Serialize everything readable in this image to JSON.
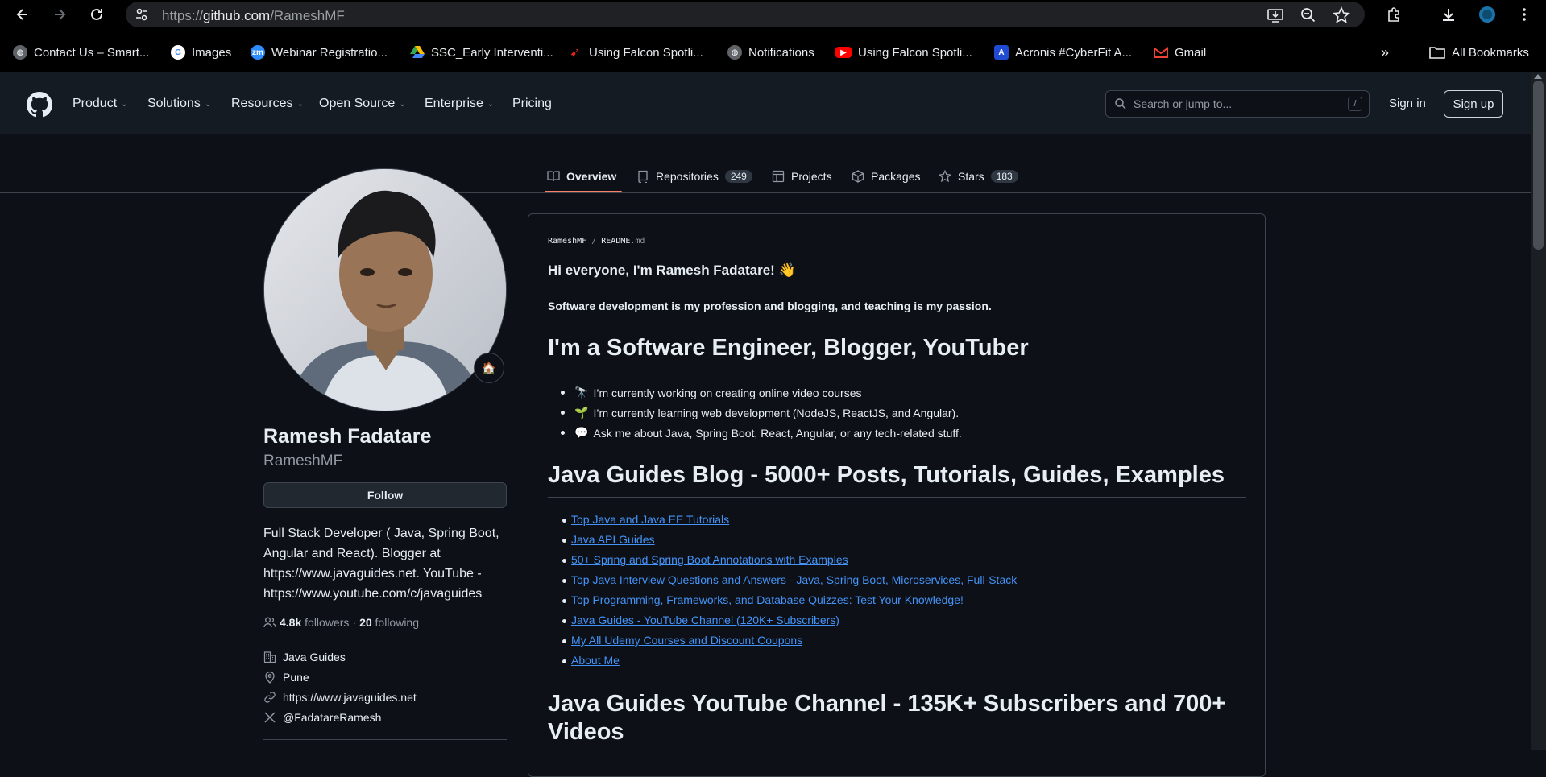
{
  "browser": {
    "url_scheme": "https://",
    "url_host": "github.com",
    "url_path": "/RameshMF",
    "bookmarks": [
      {
        "label": "Contact Us – Smart...",
        "icon": "globe-icon",
        "color": "#9aa0a6"
      },
      {
        "label": "Images",
        "icon": "google-icon",
        "color": "#4285f4"
      },
      {
        "label": "Webinar Registratio...",
        "icon": "zoom-icon",
        "color": "#2d8cff"
      },
      {
        "label": "SSC_Early Interventi...",
        "icon": "drive-icon",
        "color": "#fbbc04"
      },
      {
        "label": "Using Falcon Spotli...",
        "icon": "falcon-icon",
        "color": "#e0251b"
      },
      {
        "label": "Notifications",
        "icon": "globe-icon",
        "color": "#9aa0a6"
      },
      {
        "label": "Using Falcon Spotli...",
        "icon": "youtube-icon",
        "color": "#ff0000"
      },
      {
        "label": "Acronis #CyberFit A...",
        "icon": "acronis-icon",
        "color": "#1e4bd2"
      },
      {
        "label": "Gmail",
        "icon": "gmail-icon",
        "color": "#ea4335"
      }
    ],
    "more_bookmarks": "»",
    "all_bookmarks": "All Bookmarks"
  },
  "header": {
    "nav": [
      {
        "label": "Product",
        "dropdown": true
      },
      {
        "label": "Solutions",
        "dropdown": true
      },
      {
        "label": "Resources",
        "dropdown": true
      },
      {
        "label": "Open Source",
        "dropdown": true
      },
      {
        "label": "Enterprise",
        "dropdown": true
      },
      {
        "label": "Pricing",
        "dropdown": false
      }
    ],
    "search_placeholder": "Search or jump to...",
    "search_shortcut": "/",
    "sign_in": "Sign in",
    "sign_up": "Sign up"
  },
  "tabs": [
    {
      "label": "Overview",
      "icon": "book-icon",
      "count": null,
      "active": true
    },
    {
      "label": "Repositories",
      "icon": "repo-icon",
      "count": "249",
      "active": false
    },
    {
      "label": "Projects",
      "icon": "table-icon",
      "count": null,
      "active": false
    },
    {
      "label": "Packages",
      "icon": "package-icon",
      "count": null,
      "active": false
    },
    {
      "label": "Stars",
      "icon": "star-icon",
      "count": "183",
      "active": false
    }
  ],
  "profile": {
    "name": "Ramesh Fadatare",
    "username": "RameshMF",
    "status_emoji": "🏠",
    "follow_label": "Follow",
    "bio": "Full Stack Developer ( Java, Spring Boot, Angular and React). Blogger at https://www.javaguides.net. YouTube - https://www.youtube.com/c/javaguides",
    "followers": "4.8k",
    "followers_label": "followers",
    "separator": "·",
    "following": "20",
    "following_label": "following",
    "company": "Java Guides",
    "location": "Pune",
    "website": "https://www.javaguides.net",
    "twitter": "@FadatareRamesh"
  },
  "readme": {
    "path_user": "RameshMF",
    "path_sep": "/",
    "path_file": "README",
    "path_ext": ".md",
    "greeting": "Hi everyone, I'm Ramesh Fadatare! 👋",
    "tagline": "Software development is my profession and blogging, and teaching is my passion.",
    "heading_1": "I'm a Software Engineer, Blogger, YouTuber",
    "bullets": [
      {
        "emoji": "🔭",
        "text": "I’m currently working on creating online video courses"
      },
      {
        "emoji": "🌱",
        "text": "I’m currently learning web development (NodeJS, ReactJS, and Angular)."
      },
      {
        "emoji": "💬",
        "text": "Ask me about Java, Spring Boot, React, Angular, or any tech-related stuff."
      }
    ],
    "heading_2": "Java Guides Blog - 5000+ Posts, Tutorials, Guides, Examples",
    "links": [
      "Top Java and Java EE Tutorials",
      "Java API Guides",
      "50+ Spring and Spring Boot Annotations with Examples",
      "Top Java Interview Questions and Answers - Java, Spring Boot, Microservices, Full-Stack",
      "Top Programming, Frameworks, and Database Quizzes: Test Your Knowledge!",
      "Java Guides - YouTube Channel (120K+ Subscribers)",
      "My All Udemy Courses and Discount Coupons",
      "About Me"
    ],
    "heading_3_line1": "Java Guides YouTube Channel - 135K+ Subscribers and 700+",
    "heading_3_line2": "Videos"
  },
  "colors": {
    "bg": "#0d1117",
    "header_bg": "#151b23",
    "link": "#4493f8",
    "tab_underline": "#f78166",
    "border": "#3d444d"
  }
}
